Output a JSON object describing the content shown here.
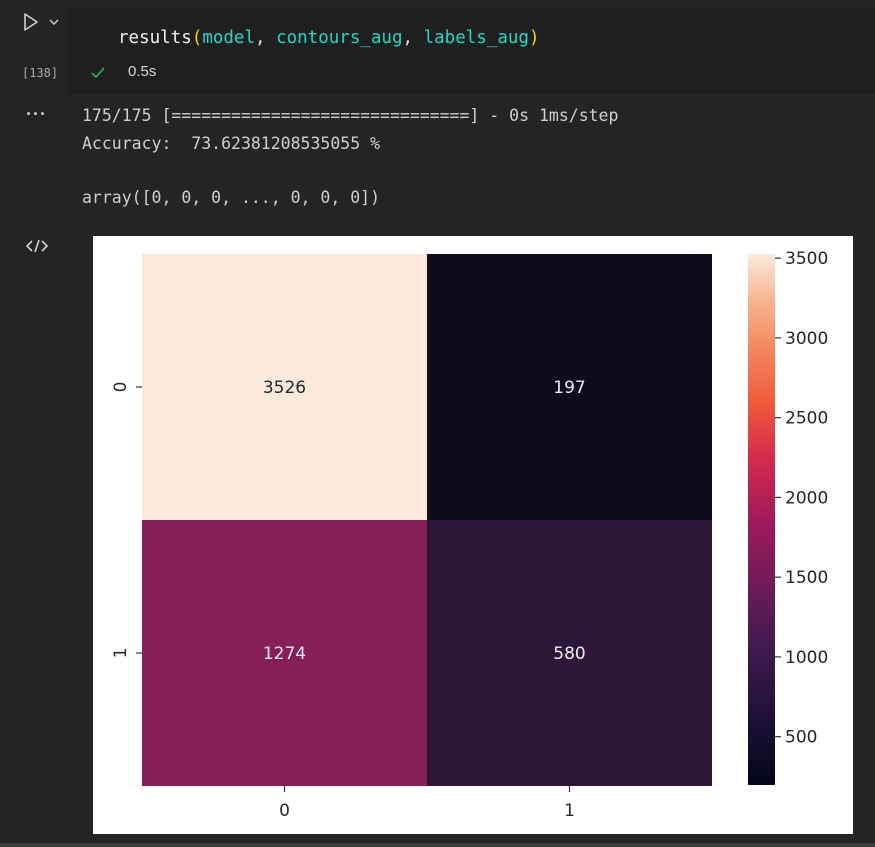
{
  "cell": {
    "execution_count": "[138]",
    "code": {
      "function": "results",
      "open_paren": "(",
      "arg1": "model",
      "arg2": "contours_aug",
      "arg3": "labels_aug",
      "close_paren": ")",
      "sep1": ", ",
      "sep2": ", "
    },
    "status": {
      "duration": "0.5s",
      "icon": "check-icon"
    },
    "output_menu": "···",
    "output_lines": [
      "175/175 [==============================] - 0s 1ms/step",
      "Accuracy:  73.62381208535055 %",
      "array([0, 0, 0, ..., 0, 0, 0])"
    ],
    "icons": {
      "run": "run-icon",
      "chevron": "chevron-down-icon",
      "output_type": "code-icon"
    }
  },
  "chart_data": {
    "type": "heatmap",
    "x_categories": [
      "0",
      "1"
    ],
    "y_categories": [
      "0",
      "1"
    ],
    "values": [
      [
        3526,
        197
      ],
      [
        1274,
        580
      ]
    ],
    "annotations": [
      "3526",
      "197",
      "1274",
      "580"
    ],
    "colorbar": {
      "ticks": [
        "500",
        "1000",
        "1500",
        "2000",
        "2500",
        "3000",
        "3500"
      ],
      "tick_values": [
        500,
        1000,
        1500,
        2000,
        2500,
        3000,
        3500
      ],
      "range": [
        197,
        3526
      ],
      "colormap": "rocket"
    },
    "colors": {
      "cell_00": "#fbe9dc",
      "cell_01": "#0f0a1e",
      "cell_10": "#861f57",
      "cell_11": "#2e1638"
    },
    "title": "",
    "xlabel": "",
    "ylabel": ""
  }
}
